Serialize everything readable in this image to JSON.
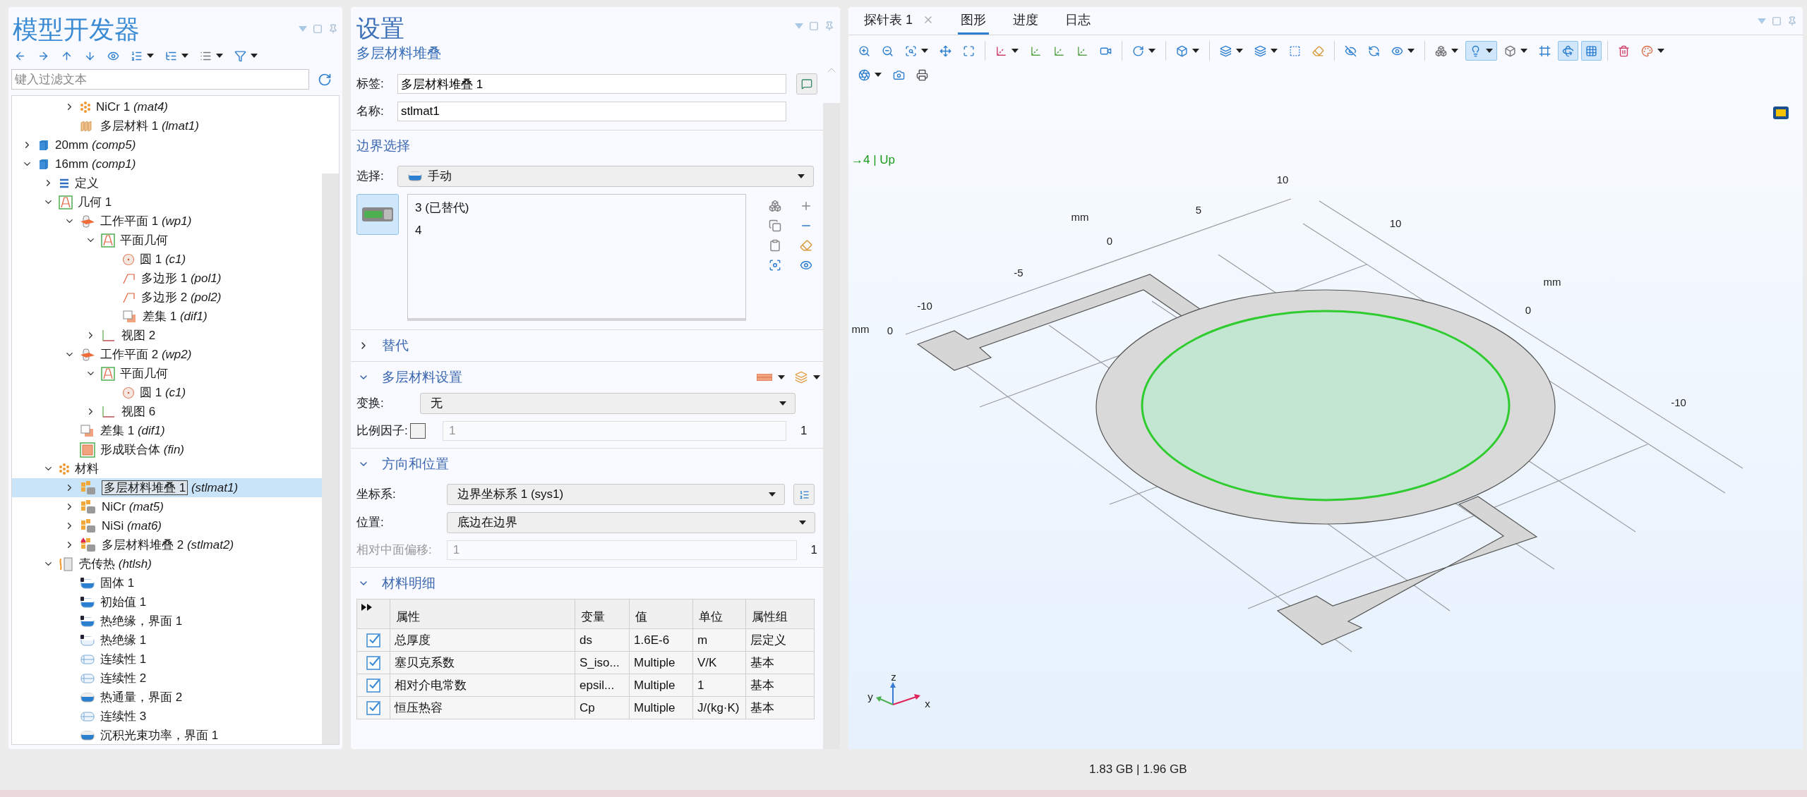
{
  "model_builder": {
    "title": "模型开发器",
    "filter": {
      "placeholder": "键入过滤文本"
    },
    "tree": [
      {
        "children": [
          {
            "children": [
              {
                "label": "NiCr 1",
                "tag": "(mat4)",
                "kind": "material",
                "expanded": false,
                "selected": false
              },
              {
                "label": "多层材料 1",
                "tag": "(lmat1)",
                "kind": "layered",
                "selected": false
              }
            ]
          }
        ]
      },
      {
        "label": "20mm",
        "tag": "(comp5)",
        "kind": "component",
        "expanded": false,
        "selected": false
      },
      {
        "label": "16mm",
        "tag": "(comp1)",
        "kind": "component",
        "expanded": true,
        "selected": false,
        "children": [
          {
            "label": "定义",
            "kind": "definitions",
            "expanded": false,
            "selected": false
          },
          {
            "label": "几何 1",
            "kind": "geometry",
            "expanded": true,
            "selected": false,
            "children": [
              {
                "label": "工作平面 1",
                "tag": "(wp1)",
                "kind": "workplane",
                "expanded": true,
                "selected": false,
                "children": [
                  {
                    "label": "平面几何",
                    "kind": "geometry",
                    "expanded": true,
                    "selected": false,
                    "children": [
                      {
                        "label": "圆 1",
                        "tag": "(c1)",
                        "kind": "circle",
                        "selected": false
                      },
                      {
                        "label": "多边形 1",
                        "tag": "(pol1)",
                        "kind": "polygon",
                        "selected": false
                      },
                      {
                        "label": "多边形 2",
                        "tag": "(pol2)",
                        "kind": "polygon",
                        "selected": false
                      },
                      {
                        "label": "差集 1",
                        "tag": "(dif1)",
                        "kind": "difference",
                        "selected": false
                      }
                    ]
                  },
                  {
                    "label": "视图 2",
                    "kind": "view",
                    "expanded": false,
                    "selected": false
                  }
                ]
              },
              {
                "label": "工作平面 2",
                "tag": "(wp2)",
                "kind": "workplane",
                "expanded": true,
                "selected": false,
                "children": [
                  {
                    "label": "平面几何",
                    "kind": "geometry",
                    "expanded": true,
                    "selected": false,
                    "children": [
                      {
                        "label": "圆 1",
                        "tag": "(c1)",
                        "kind": "circle",
                        "selected": false
                      }
                    ]
                  },
                  {
                    "label": "视图 6",
                    "kind": "view",
                    "expanded": false,
                    "selected": false
                  }
                ]
              },
              {
                "label": "差集 1",
                "tag": "(dif1)",
                "kind": "difference",
                "selected": false
              },
              {
                "label": "形成联合体",
                "tag": "(fin)",
                "kind": "union",
                "selected": false
              }
            ]
          },
          {
            "label": "材料",
            "kind": "material",
            "expanded": true,
            "selected": false,
            "children": [
              {
                "label": "多层材料堆叠 1",
                "tag": "(stlmat1)",
                "kind": "stack",
                "expanded": false,
                "selected": true
              },
              {
                "label": "NiCr",
                "tag": "(mat5)",
                "kind": "stack",
                "expanded": false,
                "selected": false
              },
              {
                "label": "NiSi",
                "tag": "(mat6)",
                "kind": "stack",
                "expanded": false,
                "selected": false
              },
              {
                "label": "多层材料堆叠 2",
                "tag": "(stlmat2)",
                "kind": "stackwarn",
                "expanded": false,
                "selected": false
              }
            ]
          },
          {
            "label": "壳传热",
            "tag": "(htlsh)",
            "kind": "physics",
            "expanded": true,
            "selected": false,
            "children": [
              {
                "label": "固体 1",
                "kind": "domain",
                "selected": false
              },
              {
                "label": "初始值 1",
                "kind": "domain",
                "selected": false
              },
              {
                "label": "热绝缘，界面 1",
                "kind": "domain",
                "selected": false
              },
              {
                "label": "热绝缘 1",
                "kind": "domainlight",
                "selected": false
              },
              {
                "label": "连续性 1",
                "kind": "continuity",
                "selected": false
              },
              {
                "label": "连续性 2",
                "kind": "continuity",
                "selected": false
              },
              {
                "label": "热通量，界面 2",
                "kind": "boundary",
                "selected": false
              },
              {
                "label": "连续性 3",
                "kind": "continuity",
                "selected": false
              },
              {
                "label": "沉积光束功率，界面 1",
                "kind": "boundary",
                "selected": false
              }
            ]
          }
        ]
      }
    ]
  },
  "settings": {
    "title": "设置",
    "subtitle": "多层材料堆叠",
    "fields": [
      {
        "label": "标签:",
        "value": "多层材料堆叠 1"
      },
      {
        "label": "名称:",
        "value": "stlmat1"
      }
    ],
    "boundary_selection": {
      "title": "边界选择",
      "selection_label": "选择:",
      "selection_value": "手动",
      "active": true,
      "entries": [
        "3 (已替代)",
        "4"
      ]
    },
    "override": {
      "title": "替代",
      "expanded": false
    },
    "layered_settings": {
      "title": "多层材料设置",
      "expanded": true,
      "transform_label": "变换:",
      "transform_value": "无",
      "scale_label": "比例因子:",
      "scale_checked": false,
      "scale_value": "1",
      "scale_unit": "1"
    },
    "orientation": {
      "title": "方向和位置",
      "expanded": true,
      "coord_label": "坐标系:",
      "coord_value": "边界坐标系 1 (sys1)",
      "position_label": "位置:",
      "position_value": "底边在边界",
      "offset_label": "相对中面偏移:",
      "offset_value": "1",
      "offset_unit": "1",
      "offset_disabled": true
    },
    "material_details": {
      "title": "材料明细",
      "expanded": true,
      "columns": [
        "属性",
        "变量",
        "值",
        "单位",
        "属性组"
      ],
      "rows": [
        {
          "checked": true,
          "cells": [
            "总厚度",
            "ds",
            "1.6E-6",
            "m",
            "层定义"
          ]
        },
        {
          "checked": true,
          "cells": [
            "塞贝克系数",
            "S_iso...",
            "Multiple",
            "V/K",
            "基本"
          ]
        },
        {
          "checked": true,
          "cells": [
            "相对介电常数",
            "epsil...",
            "Multiple",
            "1",
            "基本"
          ]
        },
        {
          "checked": true,
          "cells": [
            "恒压热容",
            "Cp",
            "Multiple",
            "J/(kg·K)",
            "基本"
          ]
        }
      ]
    }
  },
  "graphics": {
    "tabs": [
      {
        "label": "探针表 1",
        "selected": false,
        "closable": true
      },
      {
        "label": "图形",
        "selected": true,
        "closable": false
      },
      {
        "label": "进度",
        "selected": false,
        "closable": false
      },
      {
        "label": "日志",
        "selected": false,
        "closable": false
      }
    ],
    "toolbar": [
      {
        "groups": [
          [
            {
              "kind": "zoom-in",
              "menu": false,
              "pressed": false
            },
            {
              "kind": "zoom-out",
              "menu": false,
              "pressed": false
            },
            {
              "kind": "zoom-box",
              "menu": true,
              "pressed": false
            },
            {
              "kind": "zoom-extents",
              "menu": false,
              "pressed": false
            },
            {
              "kind": "zoom-fit",
              "menu": false,
              "pressed": false
            }
          ],
          [
            {
              "kind": "axes",
              "menu": true,
              "pressed": false
            },
            {
              "kind": "view-xy",
              "menu": false,
              "pressed": false
            },
            {
              "kind": "view-yz",
              "menu": false,
              "pressed": false
            },
            {
              "kind": "view-xz",
              "menu": false,
              "pressed": false
            },
            {
              "kind": "camera",
              "menu": false,
              "pressed": false
            }
          ],
          [
            {
              "kind": "rotate",
              "menu": true,
              "pressed": false
            }
          ],
          [
            {
              "kind": "domain",
              "menu": true,
              "pressed": false
            }
          ],
          [
            {
              "kind": "boundary",
              "menu": true,
              "pressed": false
            },
            {
              "kind": "boundary",
              "menu": true,
              "pressed": false
            },
            {
              "kind": "box-select",
              "menu": false,
              "pressed": false
            },
            {
              "kind": "clear",
              "menu": false,
              "pressed": false
            }
          ],
          [
            {
              "kind": "hide",
              "menu": false,
              "pressed": false
            },
            {
              "kind": "reset",
              "menu": false,
              "pressed": false
            },
            {
              "kind": "view",
              "menu": true,
              "pressed": false
            }
          ],
          [
            {
              "kind": "transparency",
              "menu": true,
              "pressed": false
            },
            {
              "kind": "lighting",
              "menu": true,
              "pressed": true
            },
            {
              "kind": "wireframe",
              "menu": true,
              "pressed": false
            },
            {
              "kind": "frame",
              "menu": false,
              "pressed": false
            },
            {
              "kind": "axis-frame",
              "menu": false,
              "pressed": true
            },
            {
              "kind": "grid",
              "menu": false,
              "pressed": true
            }
          ],
          [
            {
              "kind": "clear-plot",
              "menu": false,
              "pressed": false
            },
            {
              "kind": "color",
              "menu": true,
              "pressed": false
            }
          ]
        ]
      },
      {
        "groups": [
          [
            {
              "kind": "aperture",
              "menu": true,
              "pressed": false
            },
            {
              "kind": "screenshot",
              "menu": false,
              "pressed": false
            },
            {
              "kind": "print",
              "menu": false,
              "pressed": false
            }
          ]
        ]
      }
    ],
    "readout": "→4 | Up",
    "boundary_highlighted": true,
    "axis_labels": [
      "10",
      "mm",
      "5",
      "0",
      "-5",
      "-10",
      "mm",
      "0",
      "10",
      "mm",
      "0",
      "-10"
    ],
    "triad_labels": [
      "z",
      "y",
      "x"
    ]
  },
  "status_bar": {
    "memory": "1.83 GB | 1.96 GB"
  }
}
